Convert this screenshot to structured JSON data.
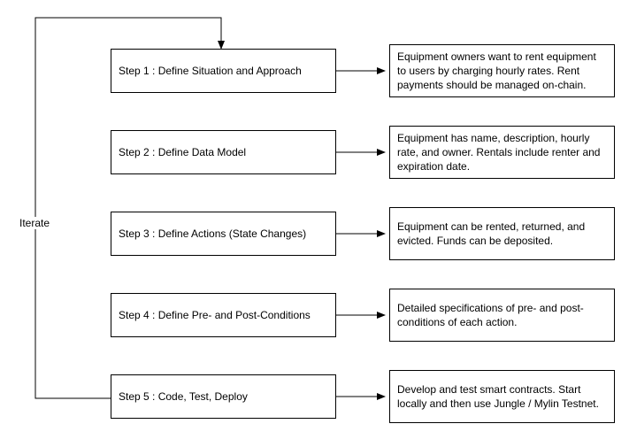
{
  "iterate_label": "Iterate",
  "steps": [
    {
      "label": "Step 1 :  Define Situation and Approach",
      "desc": "Equipment owners want to rent equipment to users by charging hourly rates. Rent payments should be managed on-chain."
    },
    {
      "label": "Step 2 : Define Data Model",
      "desc": "Equipment has name, description, hourly rate, and owner. Rentals include renter and expiration date."
    },
    {
      "label": "Step 3 : Define Actions (State Changes)",
      "desc": "Equipment can be rented, returned, and evicted. Funds can be deposited."
    },
    {
      "label": "Step 4 : Define Pre- and Post-Conditions",
      "desc": "Detailed specifications of pre- and post-conditions of each action."
    },
    {
      "label": "Step 5 : Code, Test, Deploy",
      "desc": "Develop and test smart contracts. Start locally and then use Jungle / Mylin Testnet."
    }
  ]
}
